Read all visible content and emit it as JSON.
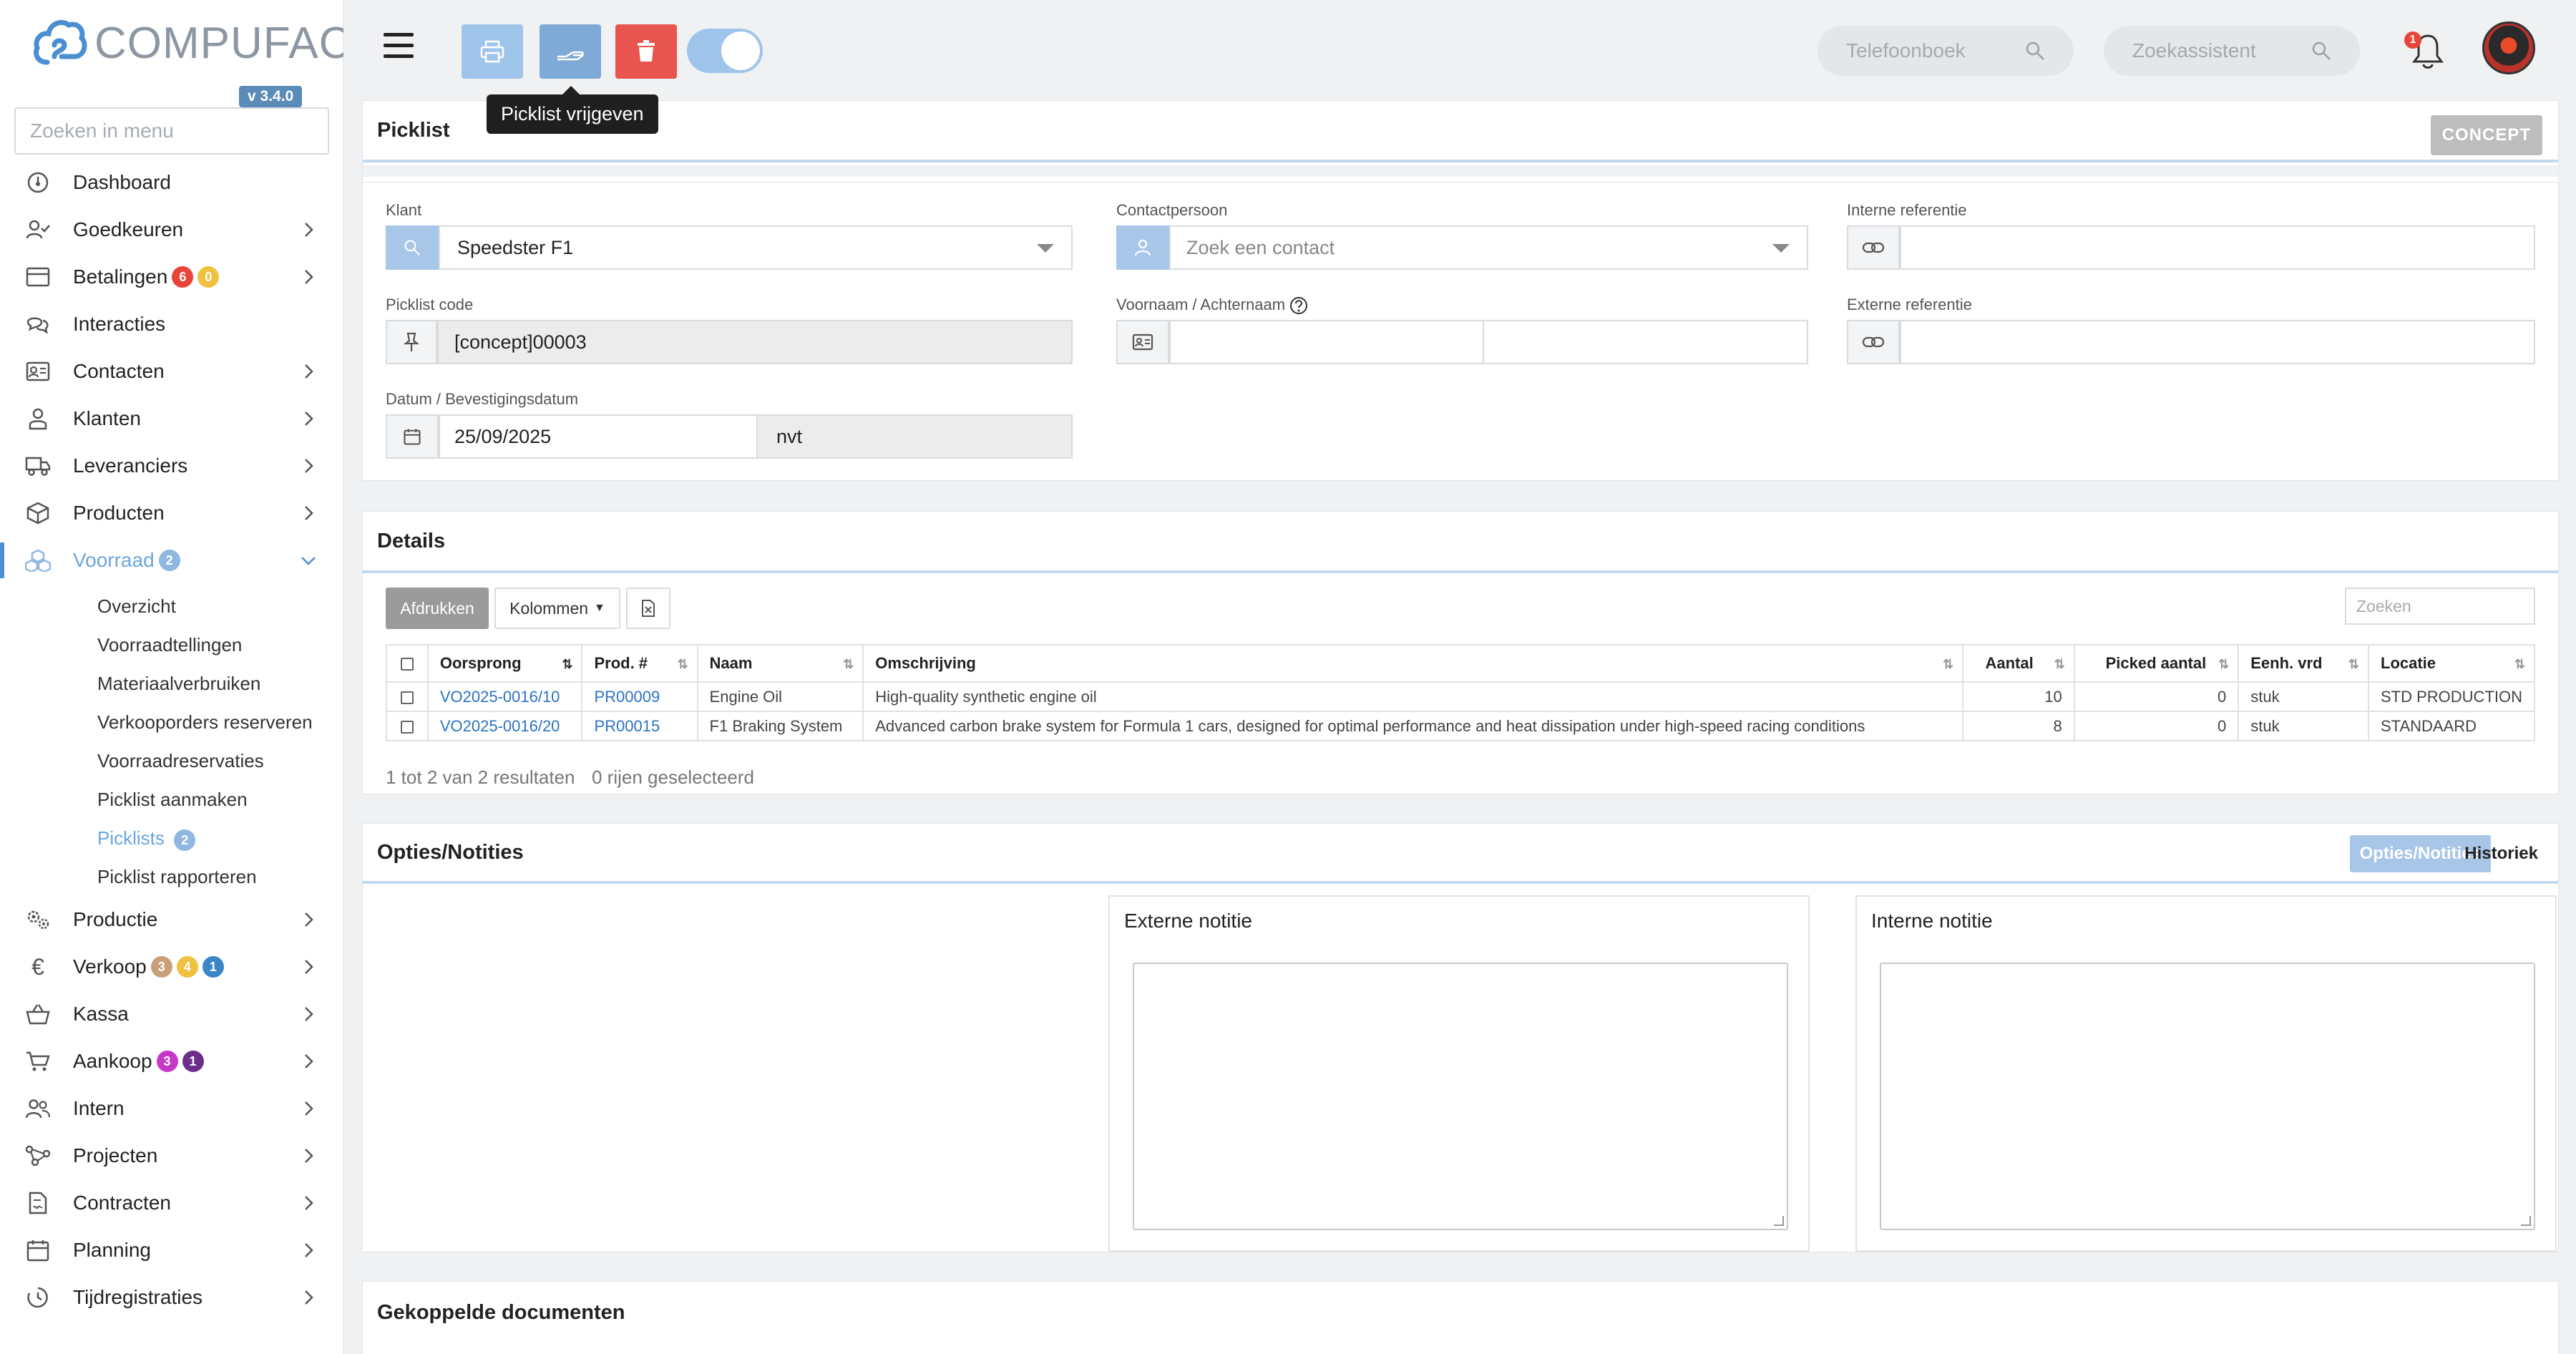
{
  "app": {
    "logo_text": "COMPUFACT",
    "version": "v 3.4.0",
    "menu_search_placeholder": "Zoeken in menu"
  },
  "sidebar": {
    "items": [
      {
        "label": "Dashboard",
        "icon": "dashboard-icon"
      },
      {
        "label": "Goedkeuren",
        "icon": "user-check-icon"
      },
      {
        "label": "Betalingen",
        "icon": "payment-card-icon",
        "badges": [
          "6",
          "0"
        ]
      },
      {
        "label": "Interacties",
        "icon": "chat-icon"
      },
      {
        "label": "Contacten",
        "icon": "contact-card-icon"
      },
      {
        "label": "Klanten",
        "icon": "customer-icon"
      },
      {
        "label": "Leveranciers",
        "icon": "truck-icon"
      },
      {
        "label": "Producten",
        "icon": "box-icon"
      },
      {
        "label": "Voorraad",
        "icon": "boxes-icon",
        "badges": [
          "2"
        ]
      },
      {
        "label": "Productie",
        "icon": "gears-icon"
      },
      {
        "label": "Verkoop",
        "icon": "euro-icon",
        "badges": [
          "3",
          "4",
          "1"
        ]
      },
      {
        "label": "Kassa",
        "icon": "basket-icon"
      },
      {
        "label": "Aankoop",
        "icon": "cart-icon",
        "badges": [
          "3",
          "1"
        ]
      },
      {
        "label": "Intern",
        "icon": "users-icon"
      },
      {
        "label": "Projecten",
        "icon": "project-icon"
      },
      {
        "label": "Contracten",
        "icon": "contract-icon"
      },
      {
        "label": "Planning",
        "icon": "calendar-icon"
      },
      {
        "label": "Tijdregistraties",
        "icon": "clock-icon"
      }
    ],
    "voorraad_sub": [
      {
        "label": "Overzicht"
      },
      {
        "label": "Voorraadtellingen"
      },
      {
        "label": "Materiaalverbruiken"
      },
      {
        "label": "Verkooporders reserveren"
      },
      {
        "label": "Voorraadreservaties"
      },
      {
        "label": "Picklist aanmaken"
      },
      {
        "label": "Picklists",
        "badge": "2"
      },
      {
        "label": "Picklist rapporteren"
      }
    ]
  },
  "topbar": {
    "tooltip": "Picklist vrijgeven",
    "phonebook_placeholder": "Telefoonboek",
    "assistant_placeholder": "Zoekassistent",
    "notification_count": "1"
  },
  "picklist": {
    "title": "Picklist",
    "status": "CONCEPT",
    "klant_label": "Klant",
    "klant_value": "Speedster F1",
    "contact_label": "Contactpersoon",
    "contact_placeholder": "Zoek een contact",
    "int_ref_label": "Interne referentie",
    "int_ref_value": "",
    "code_label": "Picklist code",
    "code_value": "[concept]00003",
    "name_label": "Voornaam / Achternaam",
    "first_name": "",
    "last_name": "",
    "ext_ref_label": "Externe referentie",
    "ext_ref_value": "",
    "date_label": "Datum / Bevestigingsdatum",
    "date_value": "25/09/2025",
    "confirm_value": "nvt"
  },
  "details": {
    "title": "Details",
    "print_label": "Afdrukken",
    "columns_label": "Kolommen",
    "search_placeholder": "Zoeken",
    "headers": [
      "Oorsprong",
      "Prod. #",
      "Naam",
      "Omschrijving",
      "Aantal",
      "Picked aantal",
      "Eenh. vrd",
      "Locatie"
    ],
    "rows": [
      {
        "origin": "VO2025-0016/10",
        "prod": "PR00009",
        "name": "Engine Oil",
        "desc": "High-quality synthetic engine oil",
        "qty": "10",
        "picked": "0",
        "unit": "stuk",
        "location": "STD PRODUCTION"
      },
      {
        "origin": "VO2025-0016/20",
        "prod": "PR00015",
        "name": "F1 Braking System",
        "desc": "Advanced carbon brake system for Formula 1 cars, designed for optimal performance and heat dissipation under high-speed racing conditions",
        "qty": "8",
        "picked": "0",
        "unit": "stuk",
        "location": "STANDAARD"
      }
    ],
    "result_text": "1 tot 2 van 2 resultaten",
    "selected_text": "0 rijen geselecteerd"
  },
  "options": {
    "title": "Opties/Notities",
    "tab_active": "Opties/Notities",
    "tab_history": "Historiek",
    "ext_note_label": "Externe notitie",
    "int_note_label": "Interne notitie"
  },
  "linked": {
    "title": "Gekoppelde documenten"
  },
  "colors": {
    "accent": "#4a8fd1",
    "delete": "#e8544e",
    "badge_red": "#e8443a",
    "badge_yellow": "#f0c040",
    "badge_tan": "#c9a07a",
    "badge_blue": "#3a86c8",
    "badge_magenta": "#c639c6",
    "badge_purple": "#6b2e8a",
    "badge_lightblue": "#8eb8e0"
  }
}
